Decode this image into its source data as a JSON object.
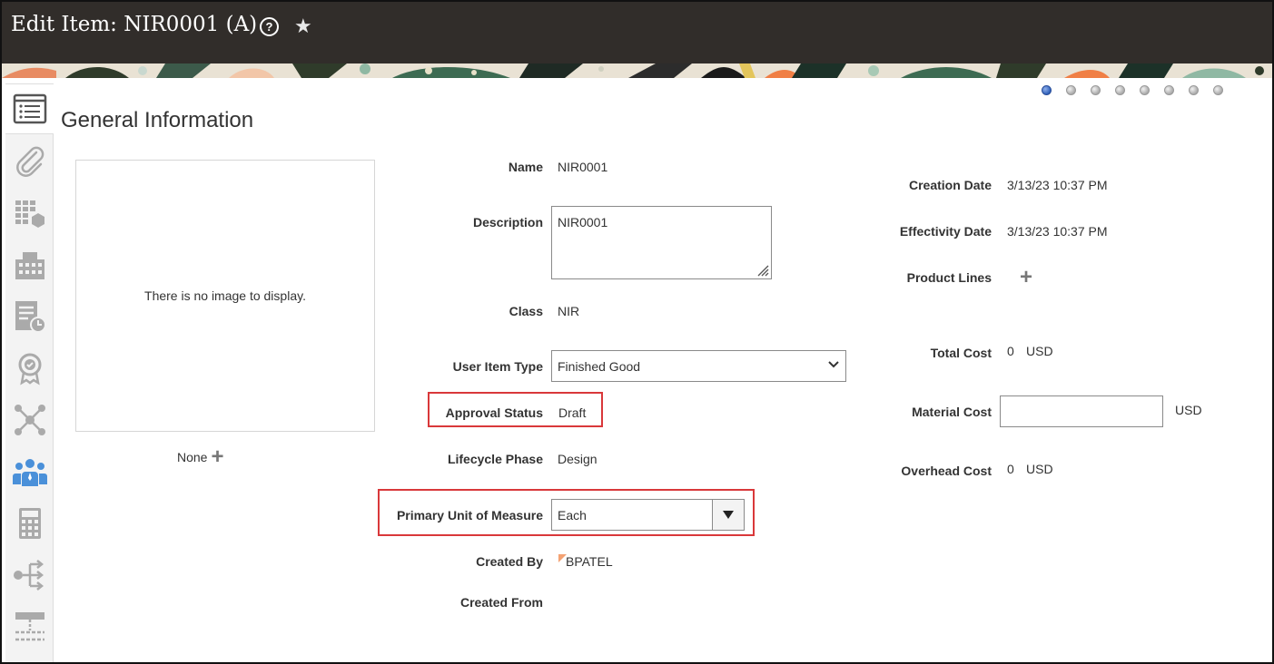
{
  "header": {
    "title": "Edit Item: NIR0001 (A)"
  },
  "icons": {
    "help": "help-circle-icon",
    "favorite": "star-icon"
  },
  "section_title": "General Information",
  "image": {
    "empty_text": "There is no image to display.",
    "caption": "None"
  },
  "fields": {
    "name": {
      "label": "Name",
      "value": "NIR0001"
    },
    "description": {
      "label": "Description",
      "value": "NIR0001"
    },
    "class": {
      "label": "Class",
      "value": "NIR"
    },
    "user_item_type": {
      "label": "User Item Type",
      "value": "Finished Good"
    },
    "approval_status": {
      "label": "Approval Status",
      "value": "Draft"
    },
    "lifecycle_phase": {
      "label": "Lifecycle Phase",
      "value": "Design"
    },
    "primary_uom": {
      "label": "Primary Unit of Measure",
      "value": "Each"
    },
    "created_by": {
      "label": "Created By",
      "value": "BPATEL"
    },
    "created_from": {
      "label": "Created From",
      "value": ""
    },
    "creation_date": {
      "label": "Creation Date",
      "value": "3/13/23 10:37 PM"
    },
    "effectivity_date": {
      "label": "Effectivity Date",
      "value": "3/13/23 10:37 PM"
    },
    "product_lines": {
      "label": "Product Lines"
    },
    "total_cost": {
      "label": "Total Cost",
      "value": "0",
      "currency": "USD"
    },
    "material_cost": {
      "label": "Material Cost",
      "value": "",
      "currency": "USD"
    },
    "overhead_cost": {
      "label": "Overhead Cost",
      "value": "0",
      "currency": "USD"
    }
  },
  "train": {
    "steps": 8,
    "active_step": 1
  },
  "colors": {
    "header_bg": "#312d2a",
    "highlight": "#d9383a",
    "active_dot": "#2f5fb8",
    "active_rail_icon": "#4a90d9"
  }
}
